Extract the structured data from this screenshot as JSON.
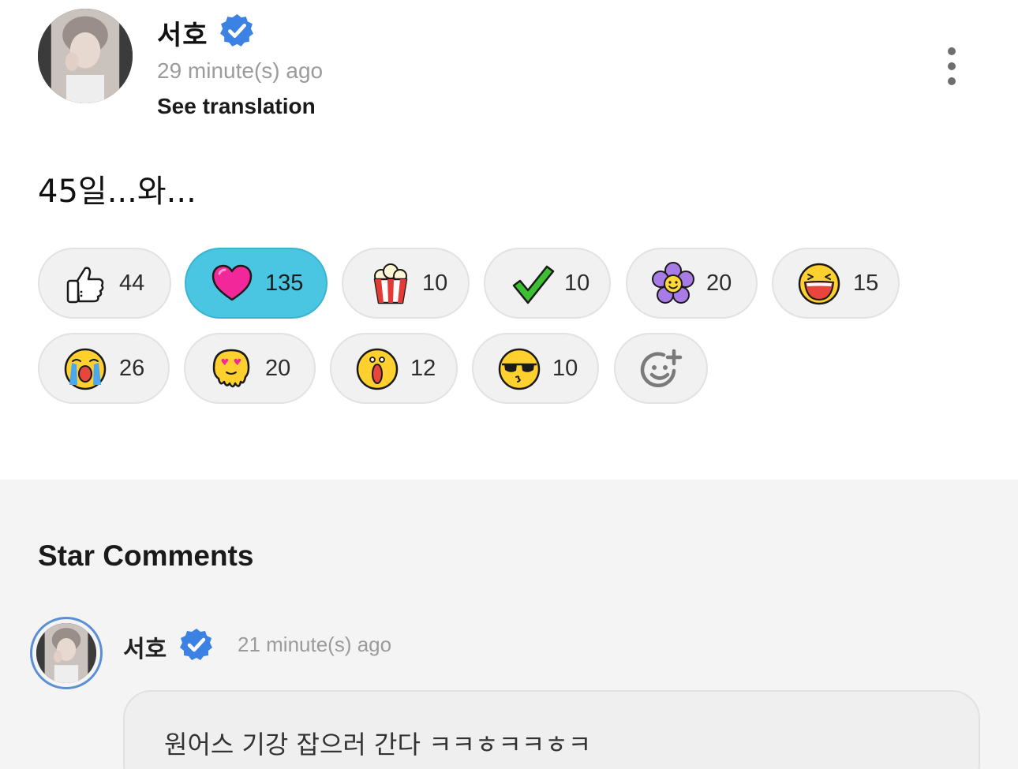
{
  "post": {
    "author": {
      "name": "서호",
      "verified": true,
      "verified_icon": "verified-badge-icon"
    },
    "time": "29 minute(s) ago",
    "translate_label": "See translation",
    "text": "45일...와...",
    "more_icon": "more-vertical-icon"
  },
  "reactions": [
    {
      "icon": "thumbs-up",
      "count": "44",
      "active": false
    },
    {
      "icon": "heart",
      "count": "135",
      "active": true
    },
    {
      "icon": "popcorn",
      "count": "10",
      "active": false
    },
    {
      "icon": "checkmark",
      "count": "10",
      "active": false
    },
    {
      "icon": "flower",
      "count": "20",
      "active": false
    },
    {
      "icon": "laughing-face",
      "count": "15",
      "active": false
    },
    {
      "icon": "crying-face",
      "count": "26",
      "active": false
    },
    {
      "icon": "melting-love-face",
      "count": "20",
      "active": false
    },
    {
      "icon": "shocked-face",
      "count": "12",
      "active": false
    },
    {
      "icon": "sunglasses-face",
      "count": "10",
      "active": false
    }
  ],
  "add_reaction_icon": "add-reaction-icon",
  "star_comments": {
    "title": "Star Comments",
    "comments": [
      {
        "author": "서호",
        "verified": true,
        "time": "21 minute(s) ago",
        "text": "원어스 기강 잡으러 간다 ㅋㅋㅎㅋㅋㅎㅋ"
      }
    ]
  },
  "colors": {
    "active_reaction": "#4ac6e2",
    "verified_badge": "#3b82e4",
    "comments_background": "#f4f4f4"
  }
}
